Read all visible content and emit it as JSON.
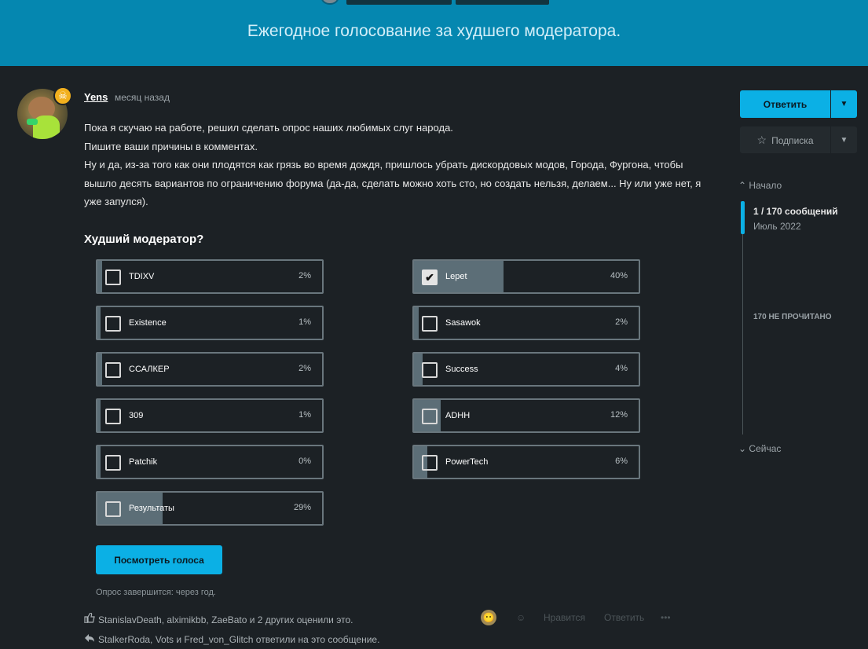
{
  "topic": {
    "title": "Ежегодное голосование за худшего модератора."
  },
  "post": {
    "author": "Yens",
    "time": "месяц назад",
    "badge_icon": "skull-icon",
    "paragraphs": [
      "Пока я скучаю на работе, решил сделать опрос наших любимых слуг народа.",
      "Пишите ваши причины в комментах.",
      "Ну и да, из-за того как они плодятся как грязь во время дождя, пришлось убрать дискордовых модов, Города, Фургона, чтобы вышло десять вариантов по ограничению форума (да-да, сделать можно хоть сто, но создать нельзя, делаем... Ну или уже нет, я уже запулся)."
    ]
  },
  "poll": {
    "title": "Худший модератор?",
    "options": [
      {
        "label": "TDIXV",
        "percent": 2,
        "percent_text": "2%",
        "checked": false
      },
      {
        "label": "Lepet",
        "percent": 40,
        "percent_text": "40%",
        "checked": true
      },
      {
        "label": "Existence",
        "percent": 1,
        "percent_text": "1%",
        "checked": false
      },
      {
        "label": "Sasawok",
        "percent": 2,
        "percent_text": "2%",
        "checked": false
      },
      {
        "label": "ССАЛКЕР",
        "percent": 2,
        "percent_text": "2%",
        "checked": false
      },
      {
        "label": "Success",
        "percent": 4,
        "percent_text": "4%",
        "checked": false
      },
      {
        "label": "309",
        "percent": 1,
        "percent_text": "1%",
        "checked": false
      },
      {
        "label": "ADHH",
        "percent": 12,
        "percent_text": "12%",
        "checked": false
      },
      {
        "label": "Patchik",
        "percent": 0,
        "percent_text": "0%",
        "checked": false
      },
      {
        "label": "PowerTech",
        "percent": 6,
        "percent_text": "6%",
        "checked": false
      },
      {
        "label": "Результаты",
        "percent": 29,
        "percent_text": "29%",
        "checked": false
      }
    ],
    "view_votes_label": "Посмотреть голоса",
    "end_text": "Опрос завершится: через год."
  },
  "reactions": {
    "likes_text": "StanislavDeath, alximikbb, ZaeBato и 2 других оценили это.",
    "replies_text": "StalkerRoda, Vots и Fred_von_Glitch ответили на это сообщение.",
    "like_label": "Нравится",
    "reply_label": "Ответить",
    "more_label": "•••",
    "like_icon": "thumbs-up-icon",
    "reply_icon": "reply-arrow-icon"
  },
  "sidebar": {
    "reply_button": "Ответить",
    "subscribe_button": "Подписка",
    "subscribe_icon": "star-icon",
    "timeline_start": "Начало",
    "timeline_count": "1 / 170 сообщений",
    "timeline_date": "Июль 2022",
    "unread": "170 НЕ ПРОЧИТАНО",
    "timeline_now": "Сейчас"
  },
  "colors": {
    "banner": "#0587b0",
    "accent": "#0bb0e5",
    "background": "#1c2125",
    "poll_fill": "#5c6e77"
  }
}
